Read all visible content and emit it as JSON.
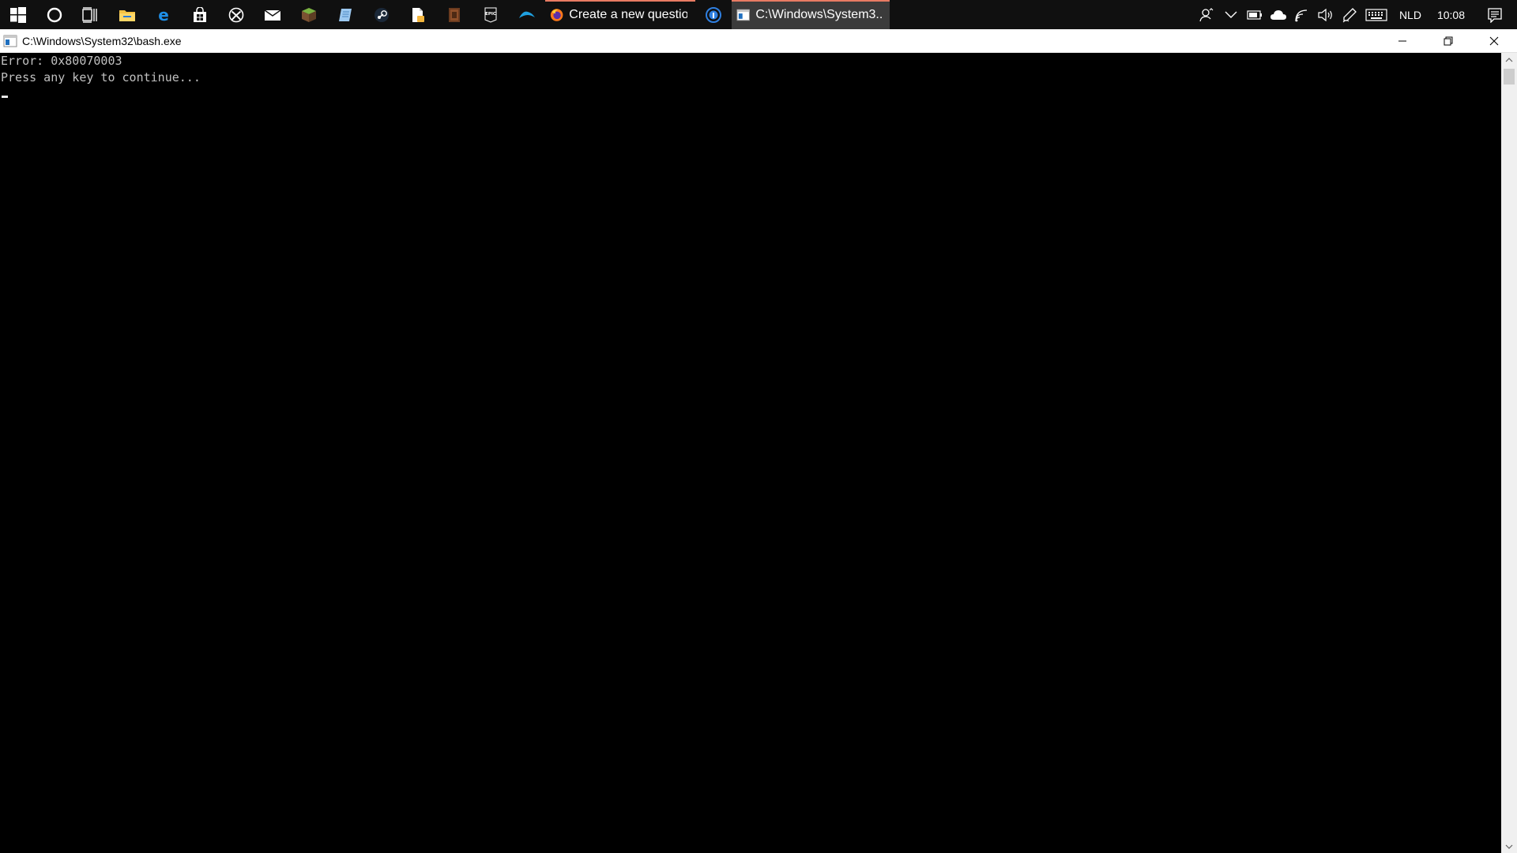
{
  "taskbar": {
    "pinned": [
      {
        "name": "start-icon"
      },
      {
        "name": "cortana-icon"
      },
      {
        "name": "task-view-icon"
      },
      {
        "name": "file-explorer-icon"
      },
      {
        "name": "edge-icon"
      },
      {
        "name": "store-icon"
      },
      {
        "name": "xbox-icon"
      },
      {
        "name": "mail-icon"
      },
      {
        "name": "minecraft-icon"
      },
      {
        "name": "notes-icon"
      },
      {
        "name": "steam-icon"
      },
      {
        "name": "document-icon"
      },
      {
        "name": "game-launcher-icon"
      },
      {
        "name": "epic-games-icon"
      },
      {
        "name": "blue-app-icon"
      }
    ],
    "firefox_label": "Create a new question...",
    "console_label": "C:\\Windows\\System3...",
    "tray": {
      "language": "NLD",
      "time": "10:08"
    }
  },
  "window": {
    "title": "C:\\Windows\\System32\\bash.exe"
  },
  "console": {
    "lines": [
      "Error: 0x80070003",
      "Press any key to continue..."
    ]
  },
  "colors": {
    "taskbar_bg": "#101010",
    "active_tab_bg": "#3b3b3b",
    "tab_accent": "#e87b63",
    "console_bg": "#000000",
    "console_text": "#c0c0c0"
  }
}
